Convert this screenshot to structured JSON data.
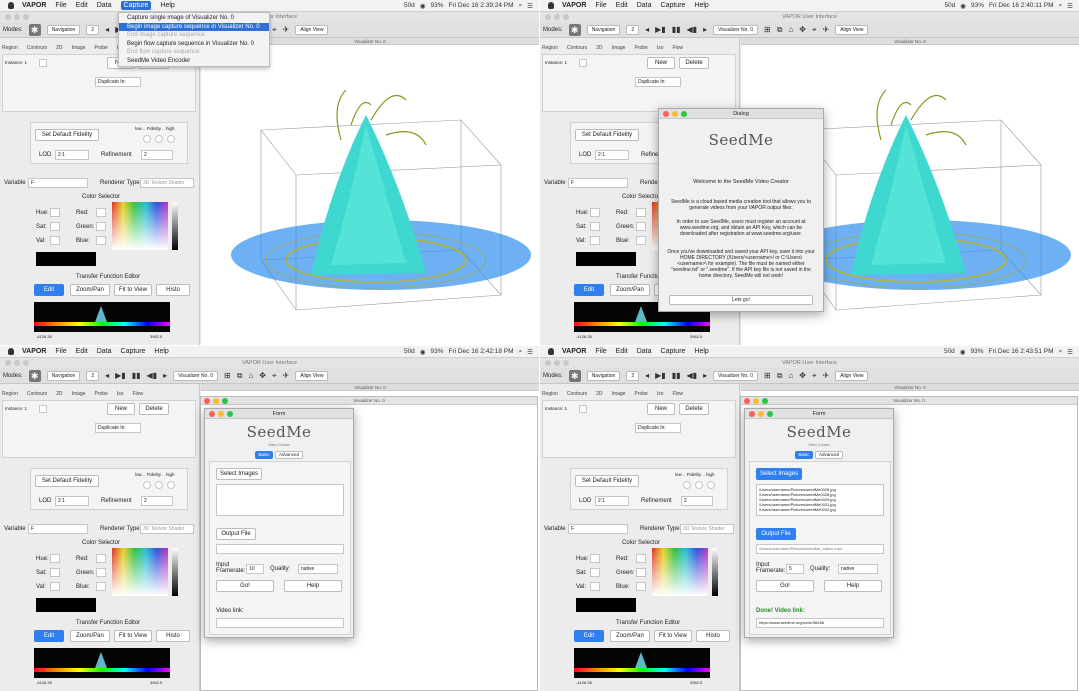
{
  "menubar": {
    "app_name": "VAPOR",
    "items": [
      "File",
      "Edit",
      "Data",
      "Capture",
      "Help"
    ],
    "status_items": [
      "50d",
      "50d"
    ],
    "battery": "93%"
  },
  "times": [
    "Fri Dec 16 2:39:24 PM",
    "Fri Dec 16 2:40:11 PM",
    "Fri Dec 16 2:42:18 PM",
    "Fri Dec 16 2:43:51 PM"
  ],
  "window_title": "VAPOR User Interface",
  "toolbar": {
    "modes_label": "Modes:",
    "mode_value": "Navigation",
    "frame_value": "2",
    "visualizer_value": "Visualizer No. 0",
    "align_view": "Align View"
  },
  "visualizer_title": "Visualizer No. 0",
  "tabs": [
    "Region",
    "Contours",
    "2D",
    "Image",
    "Probe",
    "Iso",
    "Flow"
  ],
  "panel": {
    "instance": "Instance: 1",
    "new": "New",
    "delete": "Delete",
    "duplicate": "Duplicate In:",
    "set_default_fidelity": "Set Default Fidelity",
    "fidelity_label": "low .. Fidelity .. high",
    "lod_label": "LOD",
    "lod_value": "2:1",
    "refinement_label": "Refinement",
    "refinement_value": "2",
    "variable_label": "Variable",
    "variable_value": "F",
    "renderer_type_label": "Renderer Type",
    "renderer_type_value": "3D Texture Shader",
    "color_selector": "Color Selector",
    "hue": "Hue:",
    "sat": "Sat:",
    "val": "Val:",
    "red": "Red:",
    "green": "Green:",
    "blue": "Blue:",
    "tf_editor": "Transfer Function Editor",
    "edit": "Edit",
    "zoom_pan": "Zoom/Pan",
    "fit_to_view": "Fit to View",
    "histo": "Histo",
    "tf_min": "-4126.35",
    "tf_max": "3962.5"
  },
  "capture_menu": [
    "Capture single image of Visualizer No. 0",
    "Begin image capture sequence in Visualizer No. 0",
    "End image capture sequence",
    "Begin flow capture sequence in Visualizer No. 0",
    "End flow capture sequence",
    "SeedMe Video Encoder"
  ],
  "dialog": {
    "title": "Dialog",
    "logo": "SeedMe",
    "welcome": "Welcome to the SeedMe Video Creator",
    "para1": "SeedMe is a cloud based media creation tool that allows you to generate videos from your VAPOR output files.",
    "para2": "In order to use SeedMe, users must register an account at www.seedme.org, and obtain an API Key, which can be downloaded after registration at www.seedme.org/user.",
    "para3": "Once you've downloaded and saved your API key, save it into your HOME DIRECTORY (/Users/<username>/ or C:\\Users\\<username>\\ for example). The file must be named either \"seedme.txt\" or \".seedme\". If the API key file is not saved in the home directory, SeedMe will not work!",
    "go": "Lets go!"
  },
  "form": {
    "title": "Form",
    "logo": "SeedMe",
    "logo_sub": "Video Creator",
    "tab_basic": "Basic",
    "tab_advanced": "Advanced",
    "select_images": "Select Images",
    "output_file": "Output File",
    "input_framerate": "Input Framerate:",
    "quality": "Quality:",
    "quality_value": "native",
    "framerate_value": "10",
    "framerate_value2": "5",
    "go": "Go!",
    "help": "Help",
    "video_link": "Video link:",
    "done_link": "Done! Video link:",
    "files": [
      "/Users/username/Pictures/seedMe0026.jpg",
      "/Users/username/Pictures/seedMe0028.jpg",
      "/Users/username/Pictures/seedMe0029.jpg",
      "/Users/username/Pictures/seedMe0031.jpg",
      "/Users/username/Pictures/seedMe0032.jpg"
    ],
    "output_path": "/Users/username/Pictures/seedMe_native.mp4",
    "url": "https://www.seedme.org/node/38286"
  }
}
